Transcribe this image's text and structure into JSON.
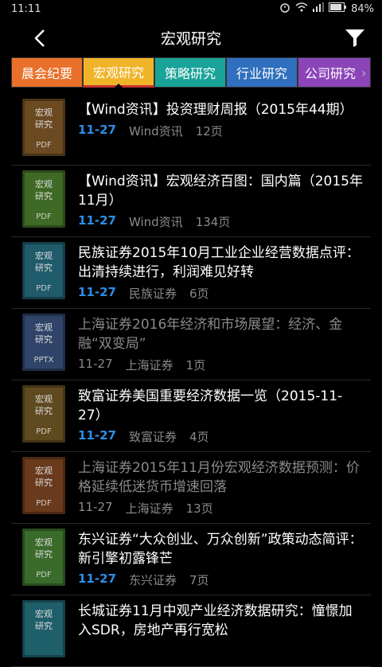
{
  "status": {
    "time": "11:11",
    "battery": "84%"
  },
  "header": {
    "title": "宏观研究"
  },
  "tabs": [
    {
      "label": "晨会纪要"
    },
    {
      "label": "宏观研究"
    },
    {
      "label": "策略研究"
    },
    {
      "label": "行业研究"
    },
    {
      "label": "公司研究"
    }
  ],
  "items": [
    {
      "thumb": [
        "宏观",
        "研究"
      ],
      "ext": "PDF",
      "title": "【Wind资讯】投资理财周报（2015年44期）",
      "date": "11-27",
      "source": "Wind资讯",
      "pages": "12页",
      "read": false
    },
    {
      "thumb": [
        "宏观",
        "研究"
      ],
      "ext": "PDF",
      "title": "【Wind资讯】宏观经济百图：国内篇（2015年11月）",
      "date": "11-27",
      "source": "Wind资讯",
      "pages": "134页",
      "read": false
    },
    {
      "thumb": [
        "宏观",
        "研究"
      ],
      "ext": "PDF",
      "title": "民族证券2015年10月工业企业经营数据点评：出清持续进行，利润难见好转",
      "date": "11-27",
      "source": "民族证券",
      "pages": "6页",
      "read": false
    },
    {
      "thumb": [
        "宏观",
        "研究"
      ],
      "ext": "PPTX",
      "title": "上海证券2016年经济和市场展望：经济、金融“双变局”",
      "date": "11-27",
      "source": "上海证券",
      "pages": "1页",
      "read": true
    },
    {
      "thumb": [
        "宏观",
        "研究"
      ],
      "ext": "PDF",
      "title": "致富证券美国重要经济数据一览（2015-11-27）",
      "date": "11-27",
      "source": "致富证券",
      "pages": "4页",
      "read": false
    },
    {
      "thumb": [
        "宏观",
        "研究"
      ],
      "ext": "PDF",
      "title": "上海证券2015年11月份宏观经济数据预测：价格延续低迷货币增速回落",
      "date": "11-27",
      "source": "上海证券",
      "pages": "13页",
      "read": true
    },
    {
      "thumb": [
        "宏观",
        "研究"
      ],
      "ext": "PDF",
      "title": "东兴证券“大众创业、万众创新”政策动态简评：新引擎初露锋芒",
      "date": "11-27",
      "source": "东兴证券",
      "pages": "7页",
      "read": false
    },
    {
      "thumb": [
        "宏观",
        "研究"
      ],
      "ext": "PDF",
      "title": "长城证券11月中观产业经济数据研究：憧憬加入SDR，房地产再行宽松",
      "date": "",
      "source": "",
      "pages": "",
      "read": false
    }
  ]
}
